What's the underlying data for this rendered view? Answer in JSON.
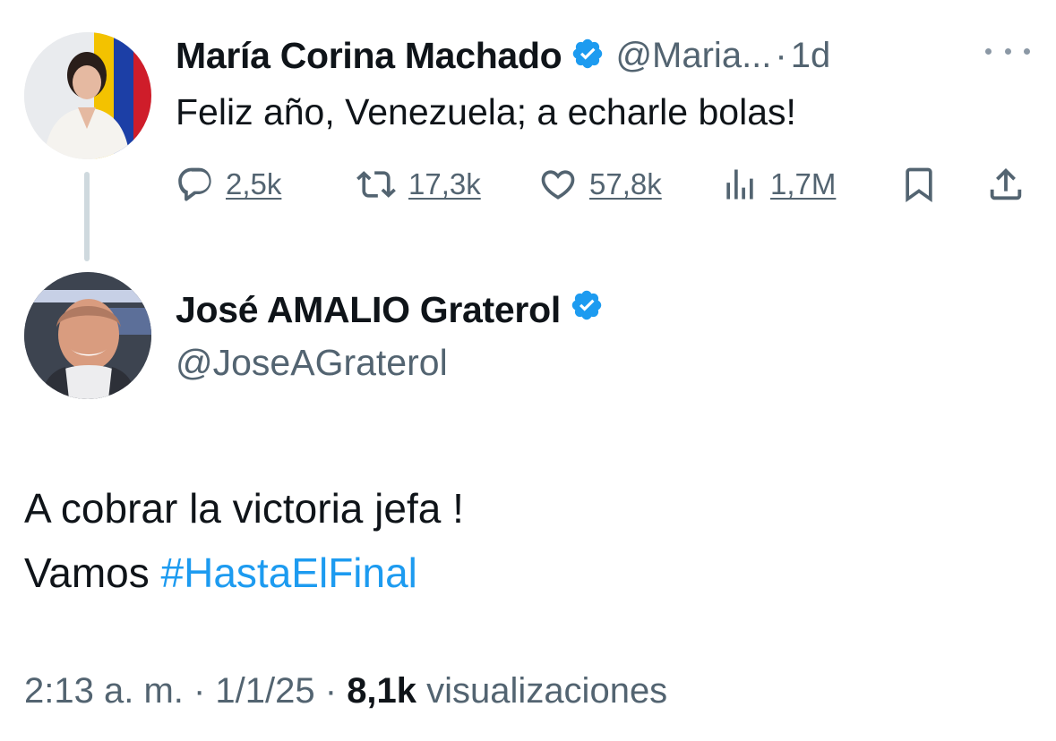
{
  "parent_tweet": {
    "author_name": "María Corina Machado",
    "handle": "@Maria...",
    "separator": "·",
    "time_ago": "1d",
    "text": "Feliz año, Venezuela; a echarle bolas!",
    "replies": "2,5k",
    "reposts": "17,3k",
    "likes": "57,8k",
    "views": "1,7M",
    "icons": [
      "reply-icon",
      "repost-icon",
      "like-icon",
      "views-icon",
      "bookmark-icon",
      "share-icon",
      "verified-badge-icon",
      "more-icon"
    ]
  },
  "reply_tweet": {
    "author_name": "José AMALIO Graterol",
    "handle": "@JoseAGraterol",
    "line1": "A cobrar la victoria jefa !",
    "line2_prefix": "Vamos ",
    "hashtag": "#HastaElFinal",
    "time": "2:13 a. m.",
    "separator": " · ",
    "date": "1/1/25",
    "views_count": "8,1k",
    "views_label": " visualizaciones"
  },
  "colors": {
    "text": "#0f1419",
    "secondary": "#536471",
    "link": "#1d9bf0",
    "verified": "#1d9bf0",
    "thread_line": "#cfd9de"
  }
}
